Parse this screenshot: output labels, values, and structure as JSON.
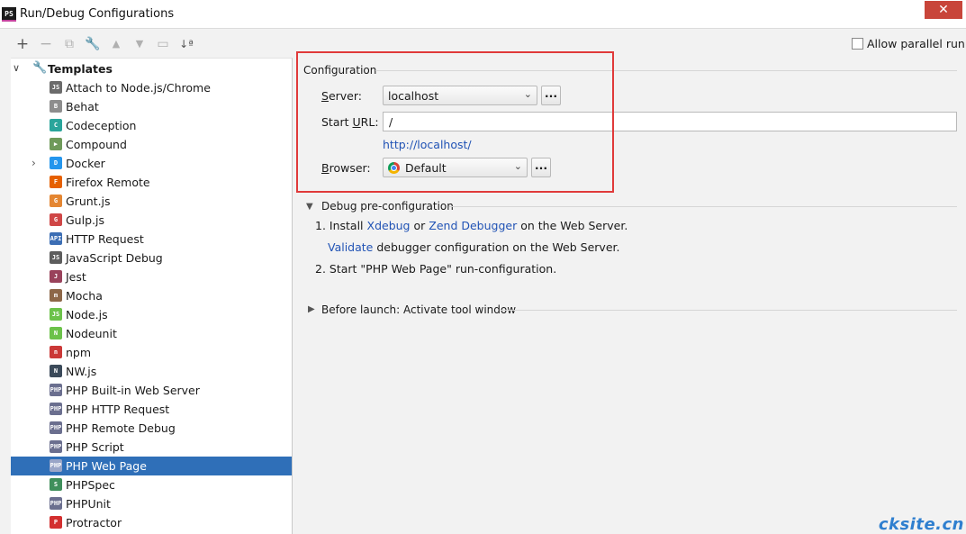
{
  "window": {
    "title": "Run/Debug Configurations",
    "logo_text": "PS",
    "close_glyph": "✕"
  },
  "toolbar": {
    "icons": [
      "plus-icon",
      "minus-icon",
      "copy-icon",
      "wrench-icon",
      "arrow-up-icon",
      "arrow-down-icon",
      "folder-icon",
      "sort-icon"
    ]
  },
  "tree": {
    "root_label": "Templates",
    "items": [
      {
        "label": "Attach to Node.js/Chrome",
        "icon": "attach-nodejs-icon",
        "color": "#6b6b6b",
        "glyph": "JS"
      },
      {
        "label": "Behat",
        "icon": "behat-icon",
        "color": "#8d8d8d",
        "glyph": "B"
      },
      {
        "label": "Codeception",
        "icon": "codeception-icon",
        "color": "#2aa59b",
        "glyph": "C"
      },
      {
        "label": "Compound",
        "icon": "compound-icon",
        "color": "#6f9a5a",
        "glyph": "▶"
      },
      {
        "label": "Docker",
        "icon": "docker-icon",
        "color": "#2496ed",
        "glyph": "D"
      },
      {
        "label": "Firefox Remote",
        "icon": "firefox-icon",
        "color": "#e66000",
        "glyph": "F"
      },
      {
        "label": "Grunt.js",
        "icon": "grunt-icon",
        "color": "#e48632",
        "glyph": "G"
      },
      {
        "label": "Gulp.js",
        "icon": "gulp-icon",
        "color": "#cf4646",
        "glyph": "G"
      },
      {
        "label": "HTTP Request",
        "icon": "http-request-icon",
        "color": "#3c6eb4",
        "glyph": "API"
      },
      {
        "label": "JavaScript Debug",
        "icon": "javascript-debug-icon",
        "color": "#5d5d5d",
        "glyph": "JS"
      },
      {
        "label": "Jest",
        "icon": "jest-icon",
        "color": "#99425b",
        "glyph": "J"
      },
      {
        "label": "Mocha",
        "icon": "mocha-icon",
        "color": "#8d6748",
        "glyph": "m"
      },
      {
        "label": "Node.js",
        "icon": "nodejs-icon",
        "color": "#6cc24a",
        "glyph": "JS"
      },
      {
        "label": "Nodeunit",
        "icon": "nodeunit-icon",
        "color": "#6cc24a",
        "glyph": "N"
      },
      {
        "label": "npm",
        "icon": "npm-icon",
        "color": "#cb3837",
        "glyph": "n"
      },
      {
        "label": "NW.js",
        "icon": "nwjs-icon",
        "color": "#3b4a5a",
        "glyph": "N"
      },
      {
        "label": "PHP Built-in Web Server",
        "icon": "php-builtin-server-icon",
        "color": "#6b6f8f",
        "glyph": "PHP"
      },
      {
        "label": "PHP HTTP Request",
        "icon": "php-http-request-icon",
        "color": "#6b6f8f",
        "glyph": "PHP"
      },
      {
        "label": "PHP Remote Debug",
        "icon": "php-remote-debug-icon",
        "color": "#6b6f8f",
        "glyph": "PHP"
      },
      {
        "label": "PHP Script",
        "icon": "php-script-icon",
        "color": "#6b6f8f",
        "glyph": "PHP"
      },
      {
        "label": "PHP Web Page",
        "icon": "php-web-page-icon",
        "color": "#9aa6c8",
        "glyph": "PHP"
      },
      {
        "label": "PHPSpec",
        "icon": "phpspec-icon",
        "color": "#3f8f5b",
        "glyph": "S"
      },
      {
        "label": "PHPUnit",
        "icon": "phpunit-icon",
        "color": "#6b6f8f",
        "glyph": "PHP"
      },
      {
        "label": "Protractor",
        "icon": "protractor-icon",
        "color": "#d32f2f",
        "glyph": "P"
      }
    ],
    "selected_index": 20,
    "expandable_index": 4
  },
  "options": {
    "allow_parallel_label": "Allow parallel run"
  },
  "configuration": {
    "section_title": "Configuration",
    "server_label_pre": "",
    "server_label_mn": "S",
    "server_label_post": "erver:",
    "server_value": "localhost",
    "start_url_label_pre": "Start ",
    "start_url_label_mn": "U",
    "start_url_label_post": "RL:",
    "start_url_value": "/",
    "resolved_url": "http://localhost/",
    "browser_label_pre": "",
    "browser_label_mn": "B",
    "browser_label_post": "rowser:",
    "browser_value": "Default",
    "dots_label": "..."
  },
  "debug": {
    "section_title": "Debug pre-configuration",
    "step1_prefix": "1. Install",
    "xdebug_link": "Xdebug",
    "or_text": "or",
    "zend_link": "Zend Debugger",
    "step1_suffix": "on the Web Server.",
    "validate_link": "Validate",
    "validate_suffix": "debugger configuration on the Web Server.",
    "step2": "2. Start \"PHP Web Page\" run-configuration."
  },
  "before_launch": {
    "title": "Before launch: Activate tool window"
  },
  "watermark": "cksite.cn",
  "colors": {
    "selection": "#2f6fb8",
    "link": "#2153b5",
    "highlight": "#e03a3a"
  }
}
